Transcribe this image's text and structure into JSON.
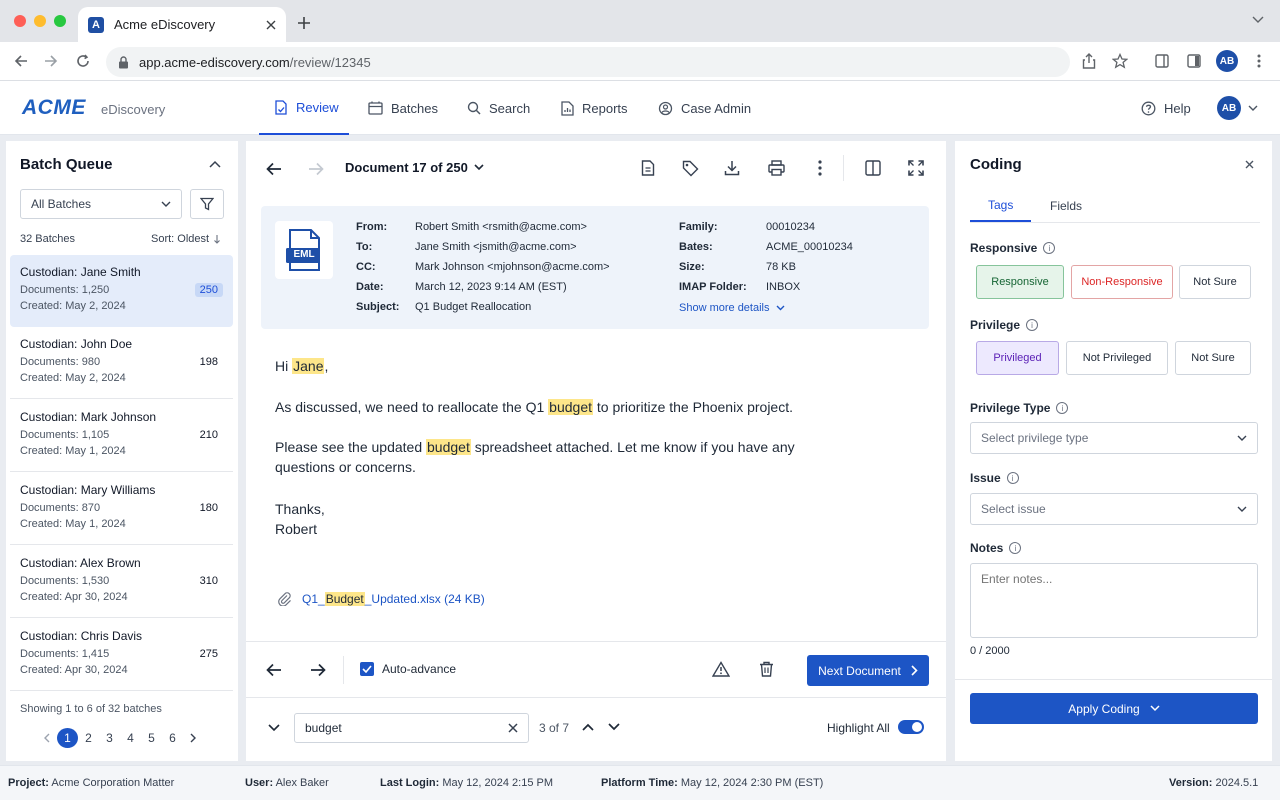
{
  "browser": {
    "tab_title": "Acme eDiscovery",
    "favicon_letter": "A",
    "url_host": "app.acme-ediscovery.com",
    "url_path": "/review/12345",
    "profile_initials": "AB"
  },
  "app": {
    "logo": "ACME",
    "logo_sub": "eDiscovery",
    "nav": [
      {
        "label": "Review",
        "icon": "review-icon"
      },
      {
        "label": "Batches",
        "icon": "batches-icon"
      },
      {
        "label": "Search",
        "icon": "search-icon"
      },
      {
        "label": "Reports",
        "icon": "reports-icon"
      },
      {
        "label": "Case Admin",
        "icon": "case-admin-icon"
      }
    ],
    "help": "Help",
    "user_initials": "AB"
  },
  "queue": {
    "title": "Batch Queue",
    "filter_value": "All Batches",
    "count": "32 Batches",
    "sort": "Sort: Oldest",
    "batches": [
      {
        "name": "Custodian: Jane Smith",
        "docs": "Documents: 1,250",
        "created": "Created: May 2, 2024",
        "badge": "250"
      },
      {
        "name": "Custodian: John Doe",
        "docs": "Documents: 980",
        "created": "Created: May 2, 2024",
        "badge": "198"
      },
      {
        "name": "Custodian: Mark Johnson",
        "docs": "Documents: 1,105",
        "created": "Created: May 1, 2024",
        "badge": "210"
      },
      {
        "name": "Custodian: Mary Williams",
        "docs": "Documents: 870",
        "created": "Created: May 1, 2024",
        "badge": "180"
      },
      {
        "name": "Custodian: Alex Brown",
        "docs": "Documents: 1,530",
        "created": "Created: Apr 30, 2024",
        "badge": "310"
      },
      {
        "name": "Custodian: Chris Davis",
        "docs": "Documents: 1,415",
        "created": "Created: Apr 30, 2024",
        "badge": "275"
      }
    ],
    "showing": "Showing 1 to 6 of 32 batches",
    "pages": [
      "1",
      "2",
      "3",
      "4",
      "5",
      "6"
    ]
  },
  "doc": {
    "title": "Document 17 of 250",
    "file_type": "EML",
    "from_label": "From:",
    "from": "Robert Smith <rsmith@acme.com>",
    "to_label": "To:",
    "to": "Jane Smith <jsmith@acme.com>",
    "cc_label": "CC:",
    "cc": "Mark Johnson <mjohnson@acme.com>",
    "date_label": "Date:",
    "date": "March 12, 2023 9:14 AM (EST)",
    "subject_label": "Subject:",
    "subject": "Q1 Budget Reallocation",
    "family_label": "Family:",
    "family": "00010234",
    "bates_label": "Bates:",
    "bates": "ACME_00010234",
    "size_label": "Size:",
    "size": "78 KB",
    "imap_label": "IMAP Folder:",
    "imap": "INBOX",
    "show_more": "Show more details",
    "greeting_pre": "Hi ",
    "greeting_name": "Jane",
    "greeting_post": ",",
    "p1_pre": "As discussed, we need to reallocate the Q1 ",
    "p1_hl": "budget",
    "p1_post": " to prioritize the Phoenix project.",
    "p2_pre": "Please see the updated ",
    "p2_hl": "budget",
    "p2_post": " spreadsheet attached. Let me know if you have any",
    "p2_line2": "questions or concerns.",
    "signoff": "Thanks,",
    "signature": "Robert",
    "attach_pre": "Q1_",
    "attach_hl": "Budget",
    "attach_post": "_Updated.xlsx (24 KB)",
    "auto_advance": "Auto-advance",
    "next_doc": "Next Document",
    "search_value": "budget",
    "hit_count": "3 of 7",
    "highlight_all": "Highlight All"
  },
  "coding": {
    "title": "Coding",
    "tabs": [
      "Tags",
      "Fields"
    ],
    "responsive_label": "Responsive",
    "responsive_opts": [
      "Responsive",
      "Non-Responsive",
      "Not Sure"
    ],
    "privilege_label": "Privilege",
    "privilege_opts": [
      "Privileged",
      "Not Privileged",
      "Not Sure"
    ],
    "privtype_label": "Privilege Type",
    "privtype_placeholder": "Select privilege type",
    "issue_label": "Issue",
    "issue_placeholder": "Select issue",
    "notes_label": "Notes",
    "notes_placeholder": "Enter notes...",
    "notes_count": "0 / 2000",
    "apply": "Apply Coding"
  },
  "status": {
    "project_label": "Project:",
    "project": "Acme Corporation Matter",
    "user_label": "User:",
    "user": "Alex Baker",
    "login_label": "Last Login:",
    "login": "May 12, 2024 2:15 PM",
    "platform_label": "Platform Time:",
    "platform": "May 12, 2024 2:30 PM (EST)",
    "version_label": "Version:",
    "version": "2024.5.1"
  },
  "colors": {
    "primary": "#1d55c5",
    "highlight": "#fde68a",
    "responsive_green": "#e6f4ea",
    "nonresp_red": "#dc2626",
    "privileged_purple": "#ede9fe"
  }
}
